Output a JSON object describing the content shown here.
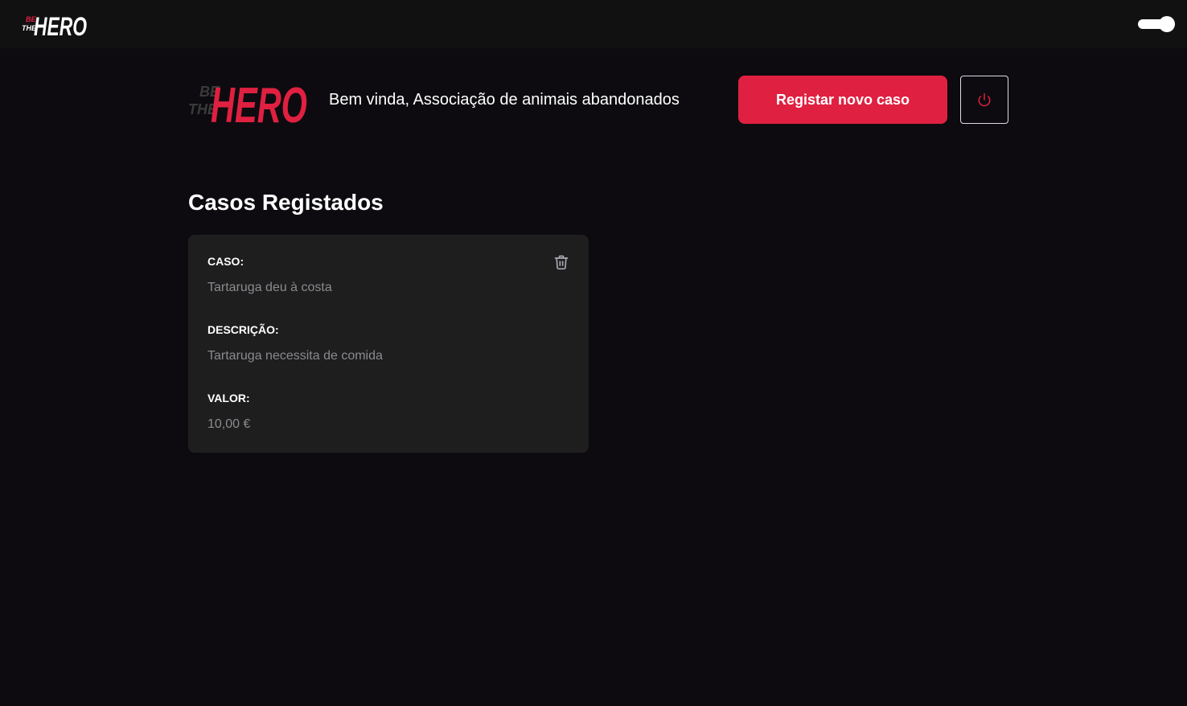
{
  "topbar": {
    "logo": {
      "word_small_1": "BE",
      "word_small_2": "THE",
      "word_big": "HERO"
    },
    "theme_toggle": {
      "state": "on"
    }
  },
  "header": {
    "logo": {
      "word_small_1": "BE",
      "word_small_2": "THE",
      "word_big": "HERO"
    },
    "welcome_text": "Bem vinda, Associação de animais abandonados",
    "new_case_label": "Registar novo caso",
    "logout_icon": "power-icon"
  },
  "main": {
    "title": "Casos Registados",
    "cases": [
      {
        "case_label": "CASO:",
        "case_value": "Tartaruga deu à costa",
        "description_label": "DESCRIÇÃO:",
        "description_value": "Tartaruga necessita de comida",
        "value_label": "VALOR:",
        "value_value": "10,00 €",
        "delete_icon": "trash-icon"
      }
    ]
  },
  "colors": {
    "background": "#0d0b0f",
    "topbar": "#111111",
    "accent": "#e02041",
    "card": "#1e1e1e",
    "muted_text": "#8a8a90"
  }
}
